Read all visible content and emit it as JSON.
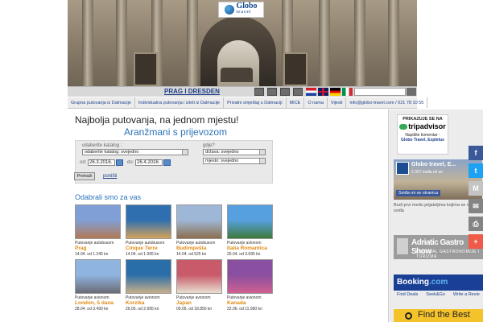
{
  "header": {
    "logo_name": "Globo",
    "logo_sub": "travel"
  },
  "topbar": {
    "title": "PRAG I DRESDEN",
    "flags": [
      "hr-flag",
      "gb-flag",
      "de-flag",
      "it-flag"
    ]
  },
  "nav": {
    "items": [
      "Grupna putovanja iz Dalmacije",
      "Individualna putovanja i izleti iz Dalmacije",
      "Privatni smještaj u Dalmaciji",
      "MICE",
      "O nama",
      "Vijesti",
      "info@globo-travel.com / 021 78 10 55"
    ]
  },
  "main": {
    "headline": "Najbolja putovanja, na jednom mjestu!",
    "subheadline": "Aranžmani s prijevozom"
  },
  "search": {
    "catalog_label": "odaberite katalog :",
    "catalog_value": "odaberite katalog: svejedno",
    "where_label": "gdje?",
    "country_value": "država: svejedno",
    "place_value": "mjesto: svejedno",
    "from_label": "od:",
    "from_date": "26.3.2016.",
    "to_label": "do:",
    "to_date": "26.4.2016.",
    "submit_label": "Pretraži",
    "reset_label": "poništi"
  },
  "selection": {
    "title": "Odabrali smo za vas",
    "cards": [
      {
        "type": "Putovanje autobusom",
        "name": "Prag",
        "info": "14.04. od 1.245 kn",
        "c1": "#7f9fd6",
        "c2": "#b37a54"
      },
      {
        "type": "Putovanje autobusom",
        "name": "Cinque Terre",
        "info": "14.04. od 1.995 kn",
        "c1": "#2f6fb0",
        "c2": "#d4a35a"
      },
      {
        "type": "Putovanje autobusom",
        "name": "Budimpešta",
        "info": "14.04. od 525 kn",
        "c1": "#9fb7d6",
        "c2": "#8b6d4d"
      },
      {
        "type": "Putovanje avionom",
        "name": "Italia Romantica",
        "info": "26.04. od 3.695 kn",
        "c1": "#57a0e0",
        "c2": "#3d7a3a"
      },
      {
        "type": "Putovanje avionom",
        "name": "London, 5 dana",
        "info": "28.04. od 3.490 kn",
        "c1": "#8fb4e0",
        "c2": "#6b6b75"
      },
      {
        "type": "Putovanje avionom",
        "name": "Korzika",
        "info": "26.05. od 2.995 kn",
        "c1": "#2a6ea8",
        "c2": "#c8b08a"
      },
      {
        "type": "Putovanje avionom",
        "name": "Japan",
        "info": "09.05. od 18.850 kn",
        "c1": "#c85a6a",
        "c2": "#e8e0d0"
      },
      {
        "type": "Putovanje avionom",
        "name": "Kanada",
        "info": "22.06. od 11.990 kn",
        "c1": "#8a4fa0",
        "c2": "#d06090"
      }
    ]
  },
  "sidebar": {
    "tripadvisor_head": "PRIKAZUJE SE NA",
    "tripadvisor_logo": "tripadvisor",
    "tripadvisor_text": "Napišite komentar -",
    "tripadvisor_link": "Globo Travel, Expletus",
    "fb_name": "Globo travel, E...",
    "fb_likes": "2.357 sviđa mi se",
    "fb_like_button": "Sviđa mi se stranica",
    "fb_text": "Budi prvi među prijateljima kojima se ovo sviđa",
    "gastro_title": "Adriatic Gastro Show",
    "gastro_sub": "FESTIVAL GASTRONOMIJE I TURIZMA",
    "booking_name": "Booking",
    "booking_dot": ".com",
    "booking_tabs": [
      "Find Deals",
      "Seek&Go",
      "Write a Revie"
    ],
    "booking_find": "Find the Best"
  },
  "social": [
    {
      "icon": "facebook-icon",
      "glyph": "f",
      "color": "#3b5998"
    },
    {
      "icon": "twitter-icon",
      "glyph": "t",
      "color": "#1da1f2"
    },
    {
      "icon": "gmail-icon",
      "glyph": "M",
      "color": "#c4c4c4"
    },
    {
      "icon": "email-icon",
      "glyph": "✉",
      "color": "#848484"
    },
    {
      "icon": "print-icon",
      "glyph": "⎙",
      "color": "#848484"
    },
    {
      "icon": "share-icon",
      "glyph": "+",
      "color": "#f05a48"
    }
  ]
}
